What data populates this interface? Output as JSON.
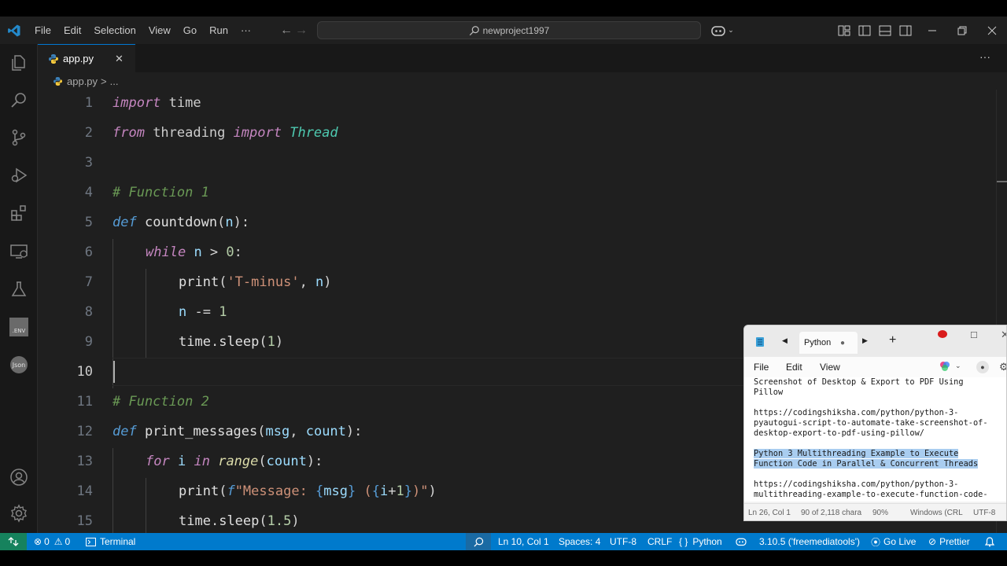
{
  "titlebar": {
    "menus": [
      "File",
      "Edit",
      "Selection",
      "View",
      "Go",
      "Run"
    ],
    "more": "···",
    "search": "newproject1997"
  },
  "tab": {
    "name": "app.py",
    "close": "✕"
  },
  "breadcrumb": {
    "file": "app.py",
    "sep": ">",
    "more": "..."
  },
  "editor": {
    "active_line": 10,
    "lines": [
      {
        "n": "1"
      },
      {
        "n": "2"
      },
      {
        "n": "3"
      },
      {
        "n": "4"
      },
      {
        "n": "5"
      },
      {
        "n": "6"
      },
      {
        "n": "7"
      },
      {
        "n": "8"
      },
      {
        "n": "9"
      },
      {
        "n": "10"
      },
      {
        "n": "11"
      },
      {
        "n": "12"
      },
      {
        "n": "13"
      },
      {
        "n": "14"
      },
      {
        "n": "15"
      }
    ],
    "tokens": {
      "l1": [
        "import",
        " time"
      ],
      "l2": [
        "from",
        " threading ",
        "import",
        " ",
        "Thread"
      ],
      "l4": [
        "# Function 1"
      ],
      "l5": [
        "def",
        " ",
        "countdown",
        "(",
        "n",
        "):"
      ],
      "l6": [
        "while",
        " ",
        "n",
        " > ",
        "0",
        ":"
      ],
      "l7": [
        "print",
        "(",
        "'T-minus'",
        ", ",
        "n",
        ")"
      ],
      "l8": [
        "n",
        " -= ",
        "1"
      ],
      "l9": [
        "time",
        ".",
        "sleep",
        "(",
        "1",
        ")"
      ],
      "l11": [
        "# Function 2"
      ],
      "l12": [
        "def",
        " ",
        "print_messages",
        "(",
        "msg",
        ", ",
        "count",
        "):"
      ],
      "l13": [
        "for",
        " ",
        "i",
        " ",
        "in",
        " ",
        "range",
        "(",
        "count",
        "):"
      ],
      "l14": [
        "print",
        "(",
        "f",
        "\"Message: ",
        "{",
        "msg",
        "}",
        " (",
        "{",
        "i",
        "+",
        "1",
        "}",
        ")\"",
        ")"
      ],
      "l15": [
        "time",
        ".",
        "sleep",
        "(",
        "1.5",
        ")"
      ]
    }
  },
  "statusbar": {
    "errors": "0",
    "warnings": "0",
    "terminal": "Terminal",
    "position": "Ln 10, Col 1",
    "spaces": "Spaces: 4",
    "encoding": "UTF-8",
    "eol": "CRLF",
    "language_braces": "{ }",
    "language": "Python",
    "interpreter": "3.10.5 ('freemediatools')",
    "golive": "Go Live",
    "prettier": "Prettier"
  },
  "notepad": {
    "tab_title": "Python",
    "menus": [
      "File",
      "Edit",
      "View"
    ],
    "paragraphs": [
      [
        "Screenshot of Desktop & Export to PDF Using",
        "Pillow"
      ],
      [
        "https://codingshiksha.com/python/python-3-",
        "pyautogui-script-to-automate-take-screenshot-of-",
        "desktop-export-to-pdf-using-pillow/"
      ]
    ],
    "selected": [
      "Python 3 Multithreading Example to Execute",
      "Function Code in Parallel & Concurrent Threads"
    ],
    "trailing": [
      "https://codingshiksha.com/python/python-3-",
      "multithreading-example-to-execute-function-code-"
    ],
    "status": {
      "position": "Ln 26, Col 1",
      "chars": "90 of 2,118 chara",
      "zoom": "90%",
      "eol": "Windows (CRL",
      "encoding": "UTF-8"
    }
  },
  "colors": {
    "accent": "#007acc",
    "editor_bg": "#1f1f1f",
    "keyword": "#c586c0",
    "comment": "#6a9955",
    "string": "#ce9178"
  }
}
